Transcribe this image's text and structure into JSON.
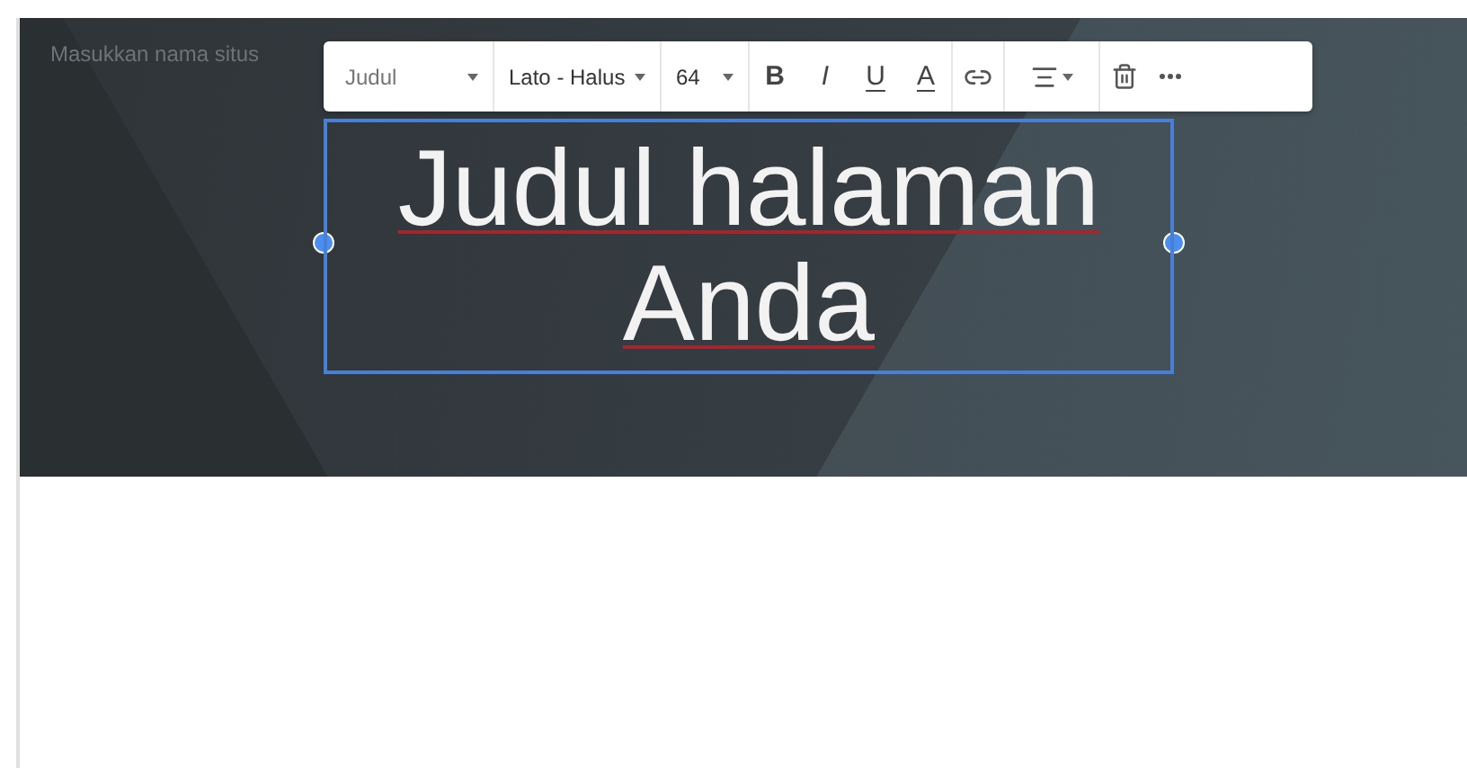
{
  "site_name": {
    "placeholder": "Masukkan nama situs"
  },
  "toolbar": {
    "style": "Judul",
    "font": "Lato - Halus",
    "size": "64",
    "bold": "B",
    "italic": "I",
    "underline": "U",
    "text_color": "A"
  },
  "title": {
    "text": "Judul halaman Anda",
    "selected": true,
    "misspelled": true
  }
}
